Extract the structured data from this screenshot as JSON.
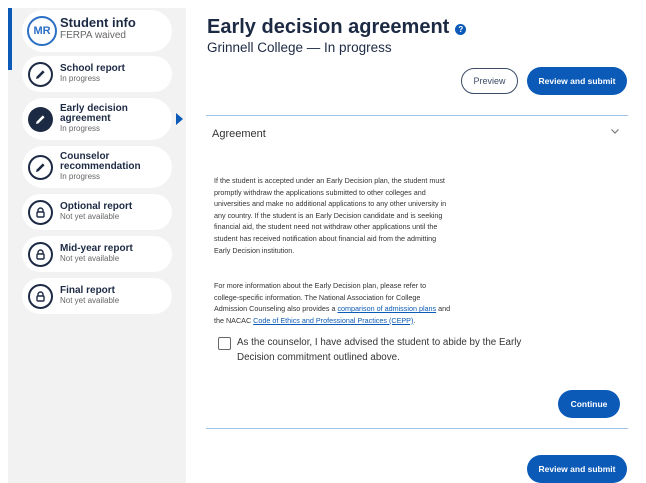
{
  "sidebar": {
    "items": [
      {
        "avatar": "MR",
        "title": "Student info",
        "status": "FERPA waived",
        "icon": "avatar-initials"
      },
      {
        "title": "School report",
        "status": "In progress",
        "icon": "pencil-icon"
      },
      {
        "title": "Early decision agreement",
        "title_lines": [
          "Early decision",
          "agreement"
        ],
        "status": "In progress",
        "icon": "pencil-icon",
        "active": true
      },
      {
        "title": "Counselor recommendation",
        "title_lines": [
          "Counselor",
          "recommendation"
        ],
        "status": "In progress",
        "icon": "pencil-icon"
      },
      {
        "title": "Optional report",
        "status": "Not yet available",
        "icon": "lock-icon"
      },
      {
        "title": "Mid-year report",
        "status": "Not yet available",
        "icon": "lock-icon"
      },
      {
        "title": "Final report",
        "status": "Not yet available",
        "icon": "lock-icon"
      }
    ]
  },
  "header": {
    "title": "Early decision agreement",
    "help_icon": "?",
    "subtitle": "Grinnell College — In progress",
    "preview_label": "Preview",
    "review_submit_label": "Review and submit"
  },
  "agreement": {
    "section_title": "Agreement",
    "paragraph1_lines": [
      "If the student is accepted under an Early Decision plan, the student must",
      "promptly withdraw the applications submitted to other colleges and",
      "universities and make no additional applications to any other university in",
      "any country. If the student is an Early Decision candidate and is seeking",
      "financial aid, the student need not withdraw other applications until the",
      "student has received notification about financial aid from the admitting",
      "Early Decision institution."
    ],
    "paragraph2": {
      "line1": "For more information about the Early Decision plan, please refer to",
      "line2": "college-specific information. The National Association for College",
      "line3_pre": "Admission Counseling also provides a ",
      "link1": "comparison of admission plans",
      "line3_post": " and",
      "line4_pre": "the NACAC ",
      "link2": "Code of Ethics and Professional Practices (CEPP)",
      "line4_post": "."
    },
    "checkbox_label": "As the counselor, I have advised the student to abide by the Early Decision commitment outlined above.",
    "checkbox_checked": false,
    "continue_label": "Continue"
  },
  "footer": {
    "review_submit_label": "Review and submit"
  },
  "colors": {
    "primary": "#0b5ab8",
    "navy": "#1d2a44",
    "sidebar_bg": "#f2f2f2",
    "rule": "#9ec4ea"
  }
}
